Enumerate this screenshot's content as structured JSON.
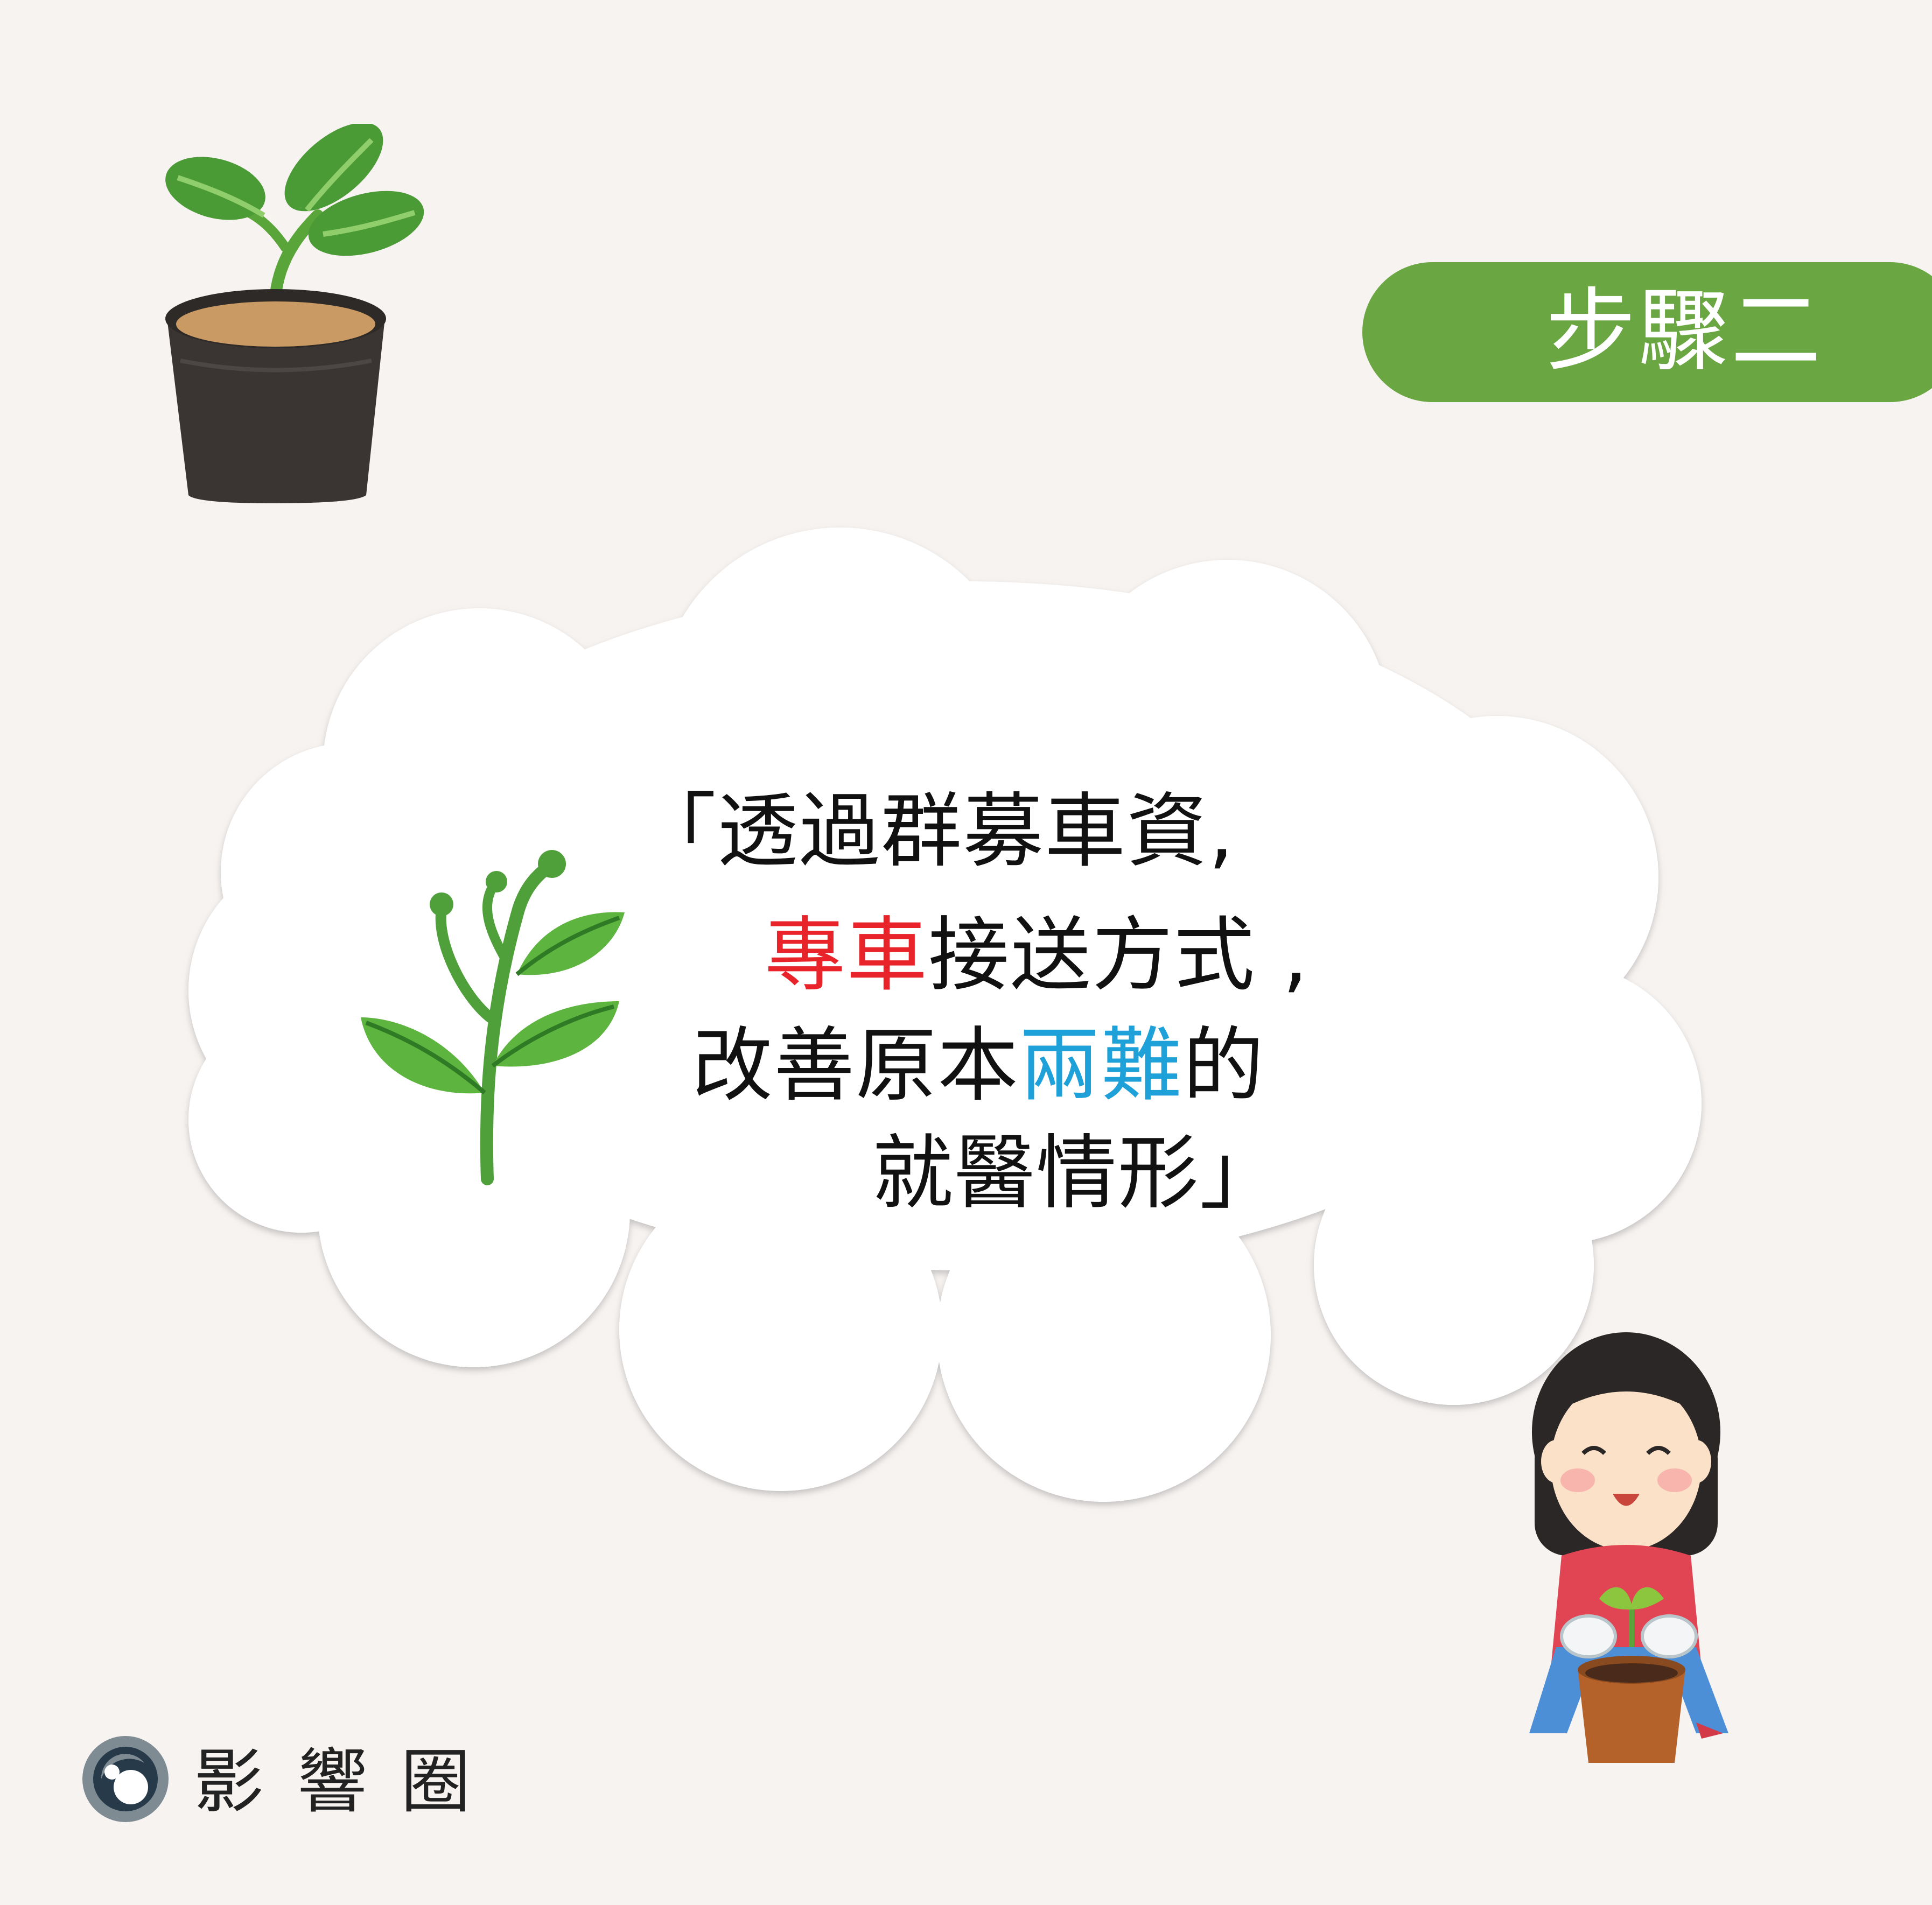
{
  "step": {
    "label": "步驟二"
  },
  "quote": {
    "line1": "「透過群募車資,",
    "line2_highlight": "專車",
    "line2_rest": "接送方式 ,",
    "line3_start": "改善原本",
    "line3_highlight": "兩難",
    "line3_end": "的",
    "line4": "就醫情形」"
  },
  "brand": {
    "name": "影響圈"
  },
  "colors": {
    "background": "#f7f3f1",
    "badge": "#6aa642",
    "highlight_red": "#e8232a",
    "highlight_blue": "#1ea0d8"
  },
  "icons": [
    "potted-seedling-icon",
    "sprout-icon",
    "gardener-girl-illustration",
    "brand-logo-icon"
  ]
}
